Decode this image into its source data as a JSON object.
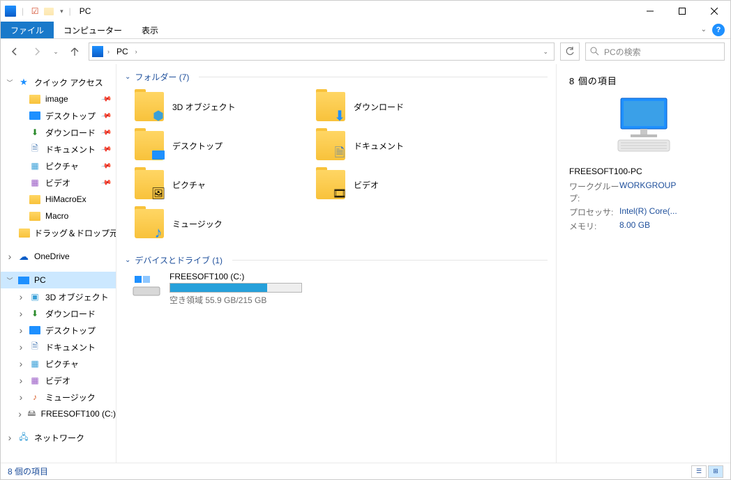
{
  "window": {
    "title": "PC"
  },
  "ribbon": {
    "file": "ファイル",
    "computer": "コンピューター",
    "view": "表示"
  },
  "address": {
    "crumb_pc": "PC"
  },
  "search": {
    "placeholder": "PCの検索"
  },
  "sidebar": {
    "quick_access": "クイック アクセス",
    "items": [
      {
        "label": "image",
        "pinned": true
      },
      {
        "label": "デスクトップ",
        "pinned": true
      },
      {
        "label": "ダウンロード",
        "pinned": true
      },
      {
        "label": "ドキュメント",
        "pinned": true
      },
      {
        "label": "ピクチャ",
        "pinned": true
      },
      {
        "label": "ビデオ",
        "pinned": true
      },
      {
        "label": "HiMacroEx",
        "pinned": false
      },
      {
        "label": "Macro",
        "pinned": false
      },
      {
        "label": "ドラッグ＆ドロップ元",
        "pinned": false
      }
    ],
    "onedrive": "OneDrive",
    "pc": "PC",
    "pc_children": [
      "3D オブジェクト",
      "ダウンロード",
      "デスクトップ",
      "ドキュメント",
      "ピクチャ",
      "ビデオ",
      "ミュージック",
      "FREESOFT100 (C:)"
    ],
    "network": "ネットワーク"
  },
  "content": {
    "folders_header": "フォルダー (7)",
    "folders": [
      "3D オブジェクト",
      "ダウンロード",
      "デスクトップ",
      "ドキュメント",
      "ピクチャ",
      "ビデオ",
      "ミュージック"
    ],
    "devices_header": "デバイスとドライブ (1)",
    "drive": {
      "name": "FREESOFT100 (C:)",
      "sub": "空き領域 55.9 GB/215 GB",
      "fill_pct": 74
    }
  },
  "details": {
    "title": "8 個の項目",
    "name": "FREESOFT100-PC",
    "rows": [
      {
        "label": "ワークグループ:",
        "value": "WORKGROUP"
      },
      {
        "label": "プロセッサ:",
        "value": "Intel(R) Core(..."
      },
      {
        "label": "メモリ:",
        "value": "8.00 GB"
      }
    ]
  },
  "status": {
    "text": "8 個の項目"
  }
}
